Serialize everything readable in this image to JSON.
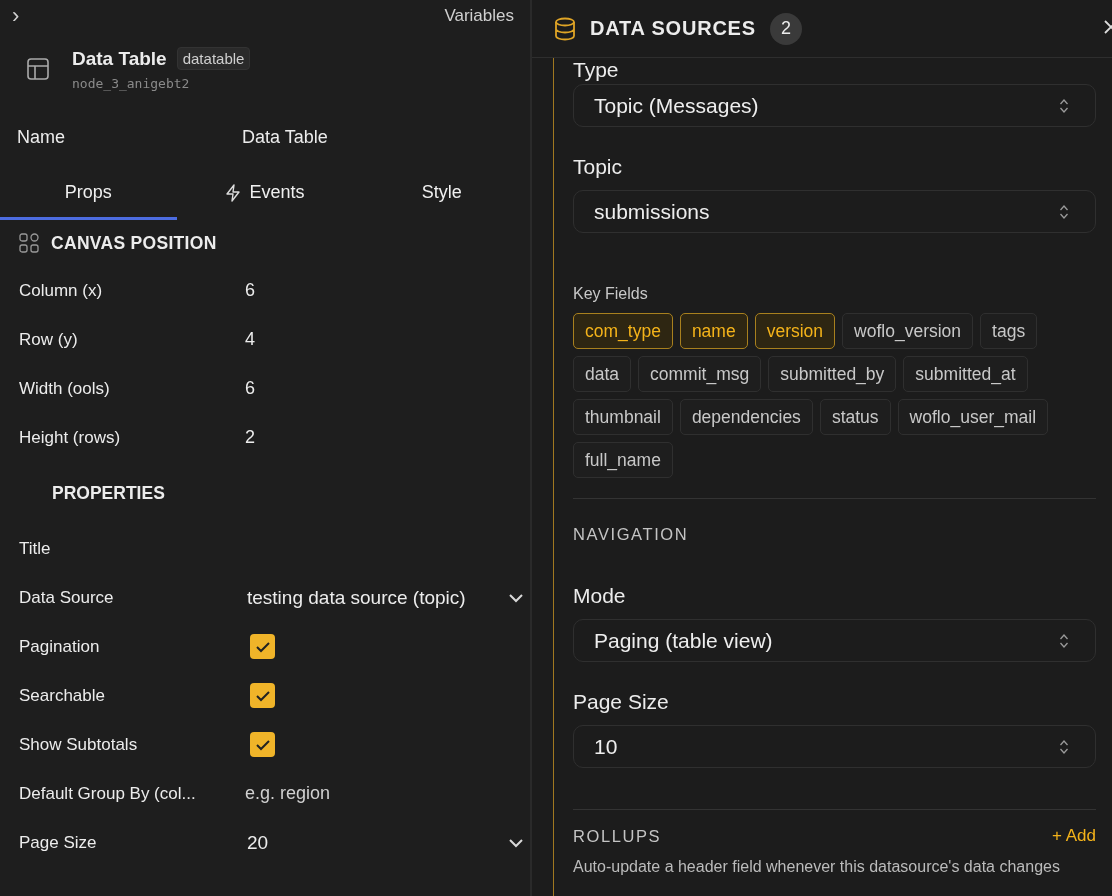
{
  "left_panel": {
    "collapse_icon": "›",
    "variables_label": "Variables",
    "component": {
      "title": "Data Table",
      "type_badge": "datatable",
      "node_id": "node_3_anigebt2"
    },
    "name_field": {
      "label": "Name",
      "value": "Data Table"
    },
    "tabs": [
      {
        "label": "Props",
        "selected": true
      },
      {
        "label": "Events",
        "selected": false
      },
      {
        "label": "Style",
        "selected": false
      }
    ],
    "canvas_position": {
      "title": "CANVAS POSITION",
      "rows": [
        {
          "label": "Column (x)",
          "value": "6"
        },
        {
          "label": "Row (y)",
          "value": "4"
        },
        {
          "label": "Width (ools)",
          "value": "6"
        },
        {
          "label": "Height (rows)",
          "value": "2"
        }
      ]
    },
    "properties": {
      "title": "PROPERTIES",
      "rows": [
        {
          "kind": "text",
          "label": "Title"
        },
        {
          "kind": "select",
          "label": "Data Source",
          "value": "testing data source (topic)"
        },
        {
          "kind": "checkbox",
          "label": "Pagination",
          "checked": true
        },
        {
          "kind": "checkbox",
          "label": "Searchable",
          "checked": true
        },
        {
          "kind": "checkbox",
          "label": "Show Subtotals",
          "checked": true
        },
        {
          "kind": "text",
          "label": "Default Group By (col...",
          "placeholder": "e.g. region"
        },
        {
          "kind": "select",
          "label": "Page Size",
          "value": "20"
        }
      ]
    }
  },
  "data_sources": {
    "title": "DATA SOURCES",
    "count": "2",
    "type_field": {
      "label": "Type",
      "value": "Topic (Messages)"
    },
    "topic_field": {
      "label": "Topic",
      "value": "submissions"
    },
    "key_fields": {
      "label": "Key Fields",
      "items": [
        {
          "label": "com_type",
          "selected": true
        },
        {
          "label": "name",
          "selected": true
        },
        {
          "label": "version",
          "selected": true
        },
        {
          "label": "woflo_version",
          "selected": false
        },
        {
          "label": "tags",
          "selected": false
        },
        {
          "label": "data",
          "selected": false
        },
        {
          "label": "commit_msg",
          "selected": false
        },
        {
          "label": "submitted_by",
          "selected": false
        },
        {
          "label": "submitted_at",
          "selected": false
        },
        {
          "label": "thumbnail",
          "selected": false
        },
        {
          "label": "dependencies",
          "selected": false
        },
        {
          "label": "status",
          "selected": false
        },
        {
          "label": "woflo_user_mail",
          "selected": false
        },
        {
          "label": "full_name",
          "selected": false
        }
      ]
    },
    "navigation": {
      "title": "NAVIGATION",
      "mode_field": {
        "label": "Mode",
        "value": "Paging (table view)"
      },
      "page_size_field": {
        "label": "Page Size",
        "value": "10"
      }
    },
    "rollups": {
      "title": "ROLLUPS",
      "add_button": "+ Add",
      "description": "Auto-update a header field whenever this datasource's data changes"
    }
  }
}
